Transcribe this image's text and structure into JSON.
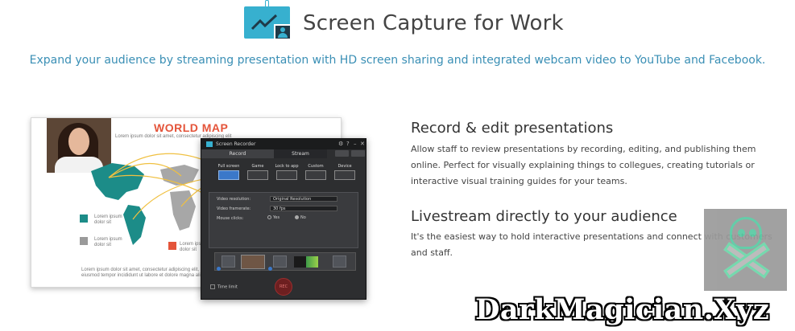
{
  "header": {
    "title": "Screen Capture for Work",
    "subtitle": "Expand your audience by streaming presentation with HD screen sharing and integrated webcam video to YouTube and Facebook.",
    "icon": "presentation-chart-icon",
    "accent": "#37b0cf",
    "subtitle_color": "#3a8fb5"
  },
  "illustration": {
    "slide": {
      "map_title": "WORLD MAP",
      "map_title_color": "#e4543a",
      "lorem_top": "Lorem ipsum dolor sit amet, consectetur adipiscing elit",
      "legend": [
        {
          "text": "Lorem ipsum dolor sit",
          "color": "#1c8c88"
        },
        {
          "text": "Lorem ipsum dolor sit",
          "color": "#9a9a9a"
        },
        {
          "text": "Lorem ipsum dolor sit",
          "color": "#e4543a"
        }
      ],
      "footer_lorem": "Lorem ipsum dolor sit amet, consectetur adipiscing elit, sed do eiusmod tempor incididunt ut labore et dolore magna aliqua"
    },
    "recorder": {
      "title": "Screen Recorder",
      "tabs": [
        "Record",
        "Stream"
      ],
      "modes": [
        "Full screen",
        "Game",
        "Lock to app",
        "Custom",
        "Device"
      ],
      "settings": [
        {
          "label": "Video resolution:",
          "value": "Original Resolution"
        },
        {
          "label": "Video framerate:",
          "value": "30 fps"
        }
      ],
      "mouse_clicks": {
        "label": "Mouse clicks:",
        "options": [
          "Yes",
          "No"
        ]
      },
      "time_limit": "Time limit",
      "rec_button": "REC"
    }
  },
  "features": [
    {
      "heading": "Record & edit presentations",
      "text": "Allow staff to review presentations by recording, editing, and publishing them online. Perfect for visually explaining things to collegues, creating tutorials or interactive visual training guides for your teams."
    },
    {
      "heading": "Livestream directly to your audience",
      "text": "It's the easiest way to hold interactive presentations and connect with customers and staff."
    }
  ],
  "watermark": {
    "text": "DarkMagician.Xyz",
    "icon": "skull-crossbones-icon"
  }
}
